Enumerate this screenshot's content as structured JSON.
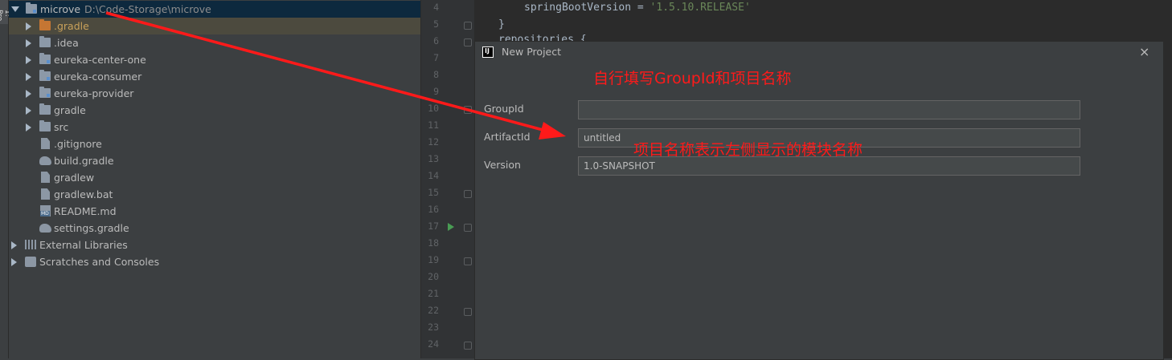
{
  "side_tab": {
    "label": "1: Pro"
  },
  "tree": {
    "root": {
      "label": "microve",
      "path": "D:\\Code-Storage\\microve"
    },
    "items": [
      {
        "label": ".gradle"
      },
      {
        "label": ".idea"
      },
      {
        "label": "eureka-center-one"
      },
      {
        "label": "eureka-consumer"
      },
      {
        "label": "eureka-provider"
      },
      {
        "label": "gradle"
      },
      {
        "label": "src"
      },
      {
        "label": ".gitignore"
      },
      {
        "label": "build.gradle"
      },
      {
        "label": "gradlew"
      },
      {
        "label": "gradlew.bat"
      },
      {
        "label": "README.md"
      },
      {
        "label": "settings.gradle"
      }
    ],
    "external_libraries": "External Libraries",
    "scratches": "Scratches and Consoles",
    "icons": [
      "folder-icon",
      "file-icon",
      "gradle-icon",
      "markdown-icon",
      "library-icon",
      "scratch-icon"
    ]
  },
  "gutter": {
    "lines": [
      "4",
      "5",
      "6",
      "7",
      "8",
      "9",
      "10",
      "11",
      "12",
      "13",
      "14",
      "15",
      "16",
      "17",
      "18",
      "19",
      "20",
      "21",
      "22",
      "23",
      "24"
    ],
    "md_badge": "MD"
  },
  "editor": {
    "line1_key": "springBootVersion = ",
    "line1_value": "'1.5.10.RELEASE'",
    "line2": "}",
    "line3": "repositories {"
  },
  "dialog": {
    "logo": "IJ",
    "title": "New Project",
    "close": "×",
    "fields": [
      {
        "label": "GroupId",
        "value": ""
      },
      {
        "label": "ArtifactId",
        "value": "untitled"
      },
      {
        "label": "Version",
        "value": "1.0-SNAPSHOT"
      }
    ]
  },
  "annotations": {
    "top": "自行填写GroupId和项目名称",
    "artifact": "项目名称表示左侧显示的模块名称",
    "color": "#ff1a1a"
  }
}
